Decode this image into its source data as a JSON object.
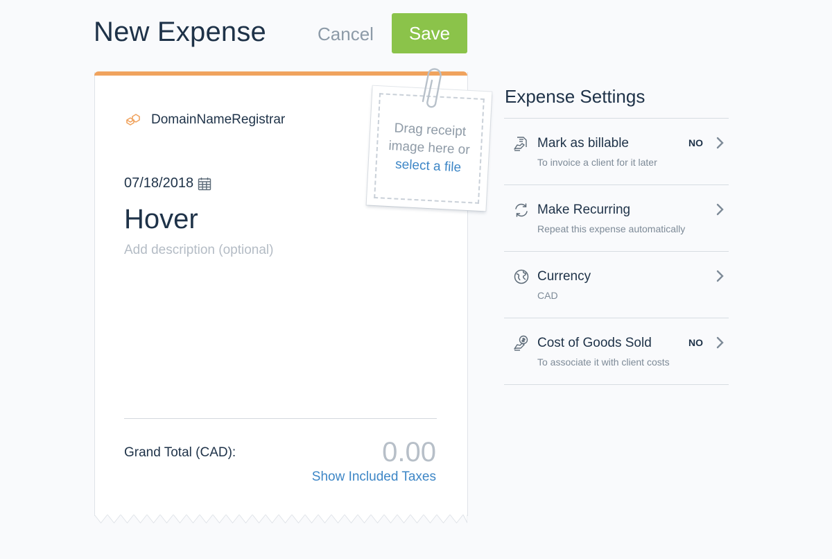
{
  "header": {
    "title": "New Expense",
    "cancel_label": "Cancel",
    "save_label": "Save"
  },
  "receipt": {
    "vendor": "DomainNameRegistrar",
    "date": "07/18/2018",
    "merchant": "Hover",
    "description_placeholder": "Add description (optional)",
    "grand_total_label": "Grand Total (CAD):",
    "grand_total_value": "0.00",
    "show_taxes_label": "Show Included Taxes"
  },
  "upload": {
    "line1": "Drag receipt",
    "line2": "image here or",
    "link": "select a file"
  },
  "settings": {
    "title": "Expense Settings",
    "items": [
      {
        "label": "Mark as billable",
        "sub": "To invoice a client for it later",
        "value": "NO",
        "icon": "billable-icon"
      },
      {
        "label": "Make Recurring",
        "sub": "Repeat this expense automatically",
        "value": "",
        "icon": "recurring-icon"
      },
      {
        "label": "Currency",
        "sub": "CAD",
        "value": "",
        "icon": "currency-icon"
      },
      {
        "label": "Cost of Goods Sold",
        "sub": "To associate it with client costs",
        "value": "NO",
        "icon": "cogs-icon"
      }
    ]
  },
  "colors": {
    "accent_orange": "#f0a35e",
    "save_green": "#8bc34a",
    "link_blue": "#3d86c6",
    "text_navy": "#1e3248"
  }
}
